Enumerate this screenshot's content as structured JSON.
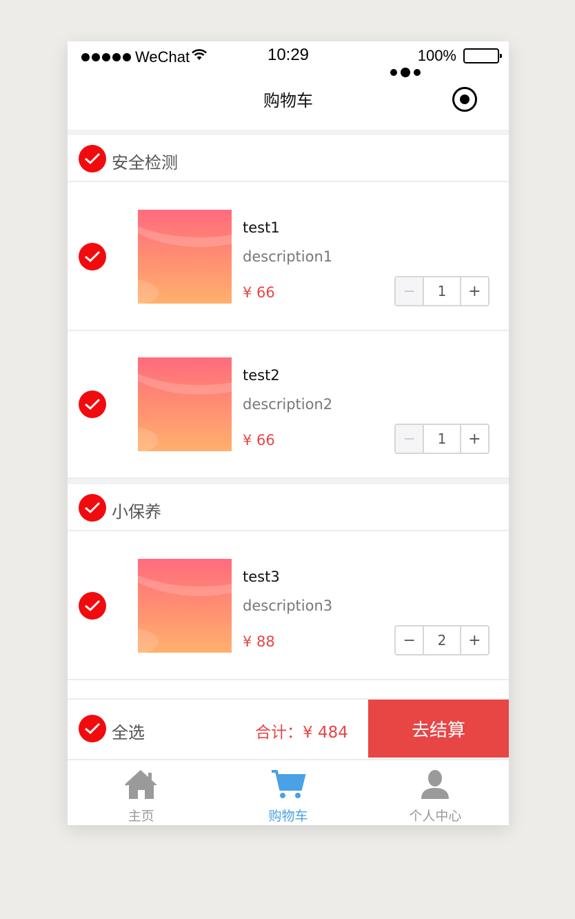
{
  "status_bar": {
    "carrier": "WeChat",
    "time": "10:29",
    "battery": "100%"
  },
  "navbar": {
    "title": "购物车"
  },
  "groups": [
    {
      "title": "安全检测",
      "items": [
        {
          "name": "test1",
          "description": "description1",
          "price": "¥ 66",
          "quantity": "1",
          "minus": "−",
          "plus": "+"
        },
        {
          "name": "test2",
          "description": "description2",
          "price": "¥ 66",
          "quantity": "1",
          "minus": "−",
          "plus": "+"
        }
      ]
    },
    {
      "title": "小保养",
      "items": [
        {
          "name": "test3",
          "description": "description3",
          "price": "¥ 88",
          "quantity": "2",
          "minus": "−",
          "plus": "+"
        }
      ]
    }
  ],
  "footer": {
    "select_all": "全选",
    "total": "合计：¥ 484",
    "checkout": "去结算"
  },
  "tabbar": [
    {
      "label": "主页",
      "icon": "home-icon"
    },
    {
      "label": "购物车",
      "icon": "cart-icon",
      "active": true
    },
    {
      "label": "个人中心",
      "icon": "user-icon"
    }
  ],
  "colors": {
    "accent_red": "#e84545",
    "check_red": "#f10b0f",
    "tab_active": "#4aa1e6",
    "tab_inactive": "#999999"
  }
}
